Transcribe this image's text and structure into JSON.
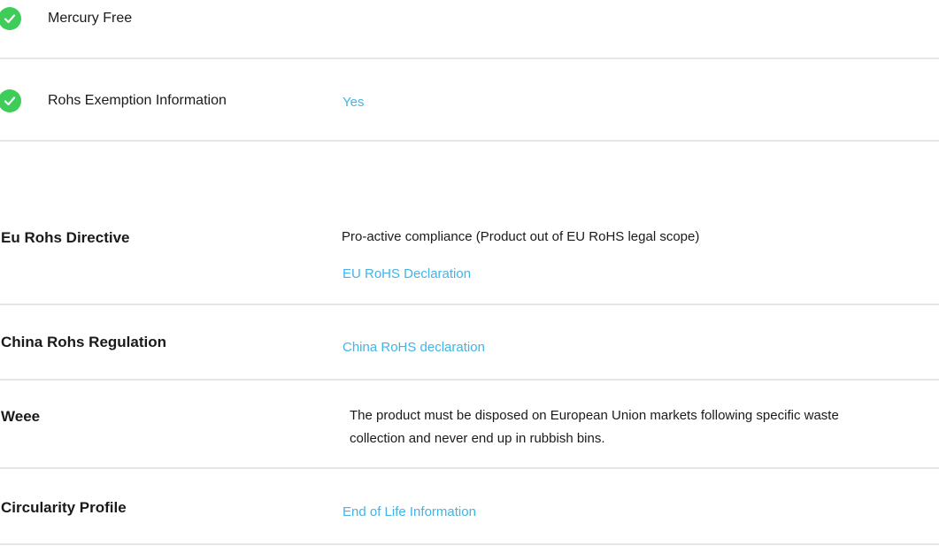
{
  "theme": {
    "check_color": "#3dcd58",
    "link_color": "#42b4e6",
    "divider_color": "#e6e6e6"
  },
  "badges": {
    "mercury_free": {
      "icon": "check-circle-icon",
      "label": "Mercury Free"
    },
    "rohs_exemption": {
      "icon": "check-circle-icon",
      "label": "Rohs Exemption Information",
      "value": "Yes"
    }
  },
  "specs": {
    "eu_rohs": {
      "label": "Eu Rohs Directive",
      "value": "Pro-active compliance (Product out of EU RoHS legal scope)",
      "link": "EU RoHS Declaration"
    },
    "china_rohs": {
      "label": "China Rohs Regulation",
      "link": "China RoHS declaration"
    },
    "weee": {
      "label": "Weee",
      "value_line1": "The product must be disposed on European Union markets following specific waste",
      "value_line2": "collection and never end up in rubbish bins."
    },
    "circularity": {
      "label": "Circularity Profile",
      "link": "End of Life Information"
    }
  }
}
